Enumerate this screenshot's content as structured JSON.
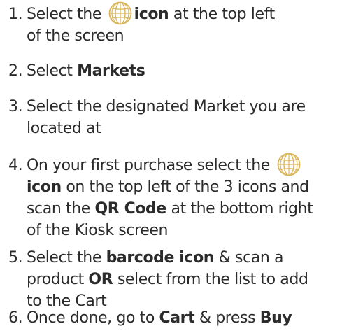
{
  "steps": [
    {
      "number": "1.",
      "line1_pre": "Select the",
      "icon": "globe-icon",
      "line1_bold": "icon",
      "line1_post": "at the top left",
      "line2": "of the screen"
    },
    {
      "number": "2.",
      "pre": "Select",
      "bold": "Markets"
    },
    {
      "number": "3.",
      "line1": "Select the designated Market you are",
      "line2": "located at"
    },
    {
      "number": "4.",
      "line1": "On your first purchase select the",
      "icon": "globe-icon",
      "line2_bold": "icon",
      "line2_post": "on the top left of the 3 icons and",
      "line3_pre": "scan the",
      "line3_bold": "QR Code",
      "line3_post": "at the bottom right",
      "line4": "of the Kiosk screen"
    },
    {
      "number": "5.",
      "line1_pre": "Select the",
      "line1_bold": "barcode icon",
      "line1_post": "& scan a",
      "line2_pre": "product",
      "line2_bold": "OR",
      "line2_post": "select from the list to add",
      "line3": "to the Cart"
    },
    {
      "number": "6.",
      "pre": "Once done, go to",
      "bold1": "Cart",
      "mid": "& press",
      "bold2": "Buy"
    }
  ],
  "colors": {
    "text": "#2b2b2b",
    "icon_gold": "#d9b45a"
  }
}
